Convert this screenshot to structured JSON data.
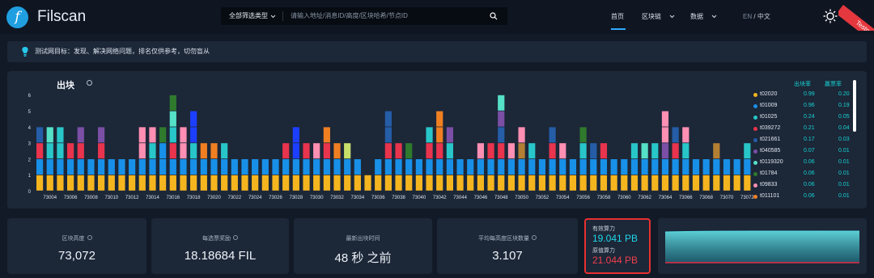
{
  "brand": {
    "name": "Filscan",
    "logo_glyph": "f"
  },
  "search": {
    "filter_label": "全部筛选类型",
    "placeholder": "请输入地址/消息ID/高度/区块哈希/节点ID"
  },
  "nav": {
    "home": "首页",
    "blockchain": "区块链",
    "data": "数据",
    "lang_en": "EN",
    "lang_sep": "/",
    "lang_zh": "中文"
  },
  "ribbon": {
    "label": "Testnet"
  },
  "notice": {
    "text": "测试网目标：发现、解决网络问题，排名仅供参考，切勿盲从"
  },
  "chart_panel": {
    "title": "出块",
    "legend_header_a": "出块率",
    "legend_header_b": "赢票率",
    "legend": [
      {
        "name": "t02020",
        "a": "0.99",
        "b": "0.20",
        "color": "#f5b51f"
      },
      {
        "name": "t01009",
        "a": "0.96",
        "b": "0.19",
        "color": "#1890e8"
      },
      {
        "name": "t01025",
        "a": "0.24",
        "b": "0.05",
        "color": "#28c6c8"
      },
      {
        "name": "t039272",
        "a": "0.21",
        "b": "0.04",
        "color": "#e8344d"
      },
      {
        "name": "t021661",
        "a": "0.17",
        "b": "0.03",
        "color": "#255da7"
      },
      {
        "name": "t040585",
        "a": "0.07",
        "b": "0.01",
        "color": "#7b4fa6"
      },
      {
        "name": "t0119320",
        "a": "0.06",
        "b": "0.01",
        "color": "#55e0c8"
      },
      {
        "name": "t01784",
        "a": "0.06",
        "b": "0.01",
        "color": "#2f7a2d"
      },
      {
        "name": "t09833",
        "a": "0.06",
        "b": "0.01",
        "color": "#ff8fb3"
      },
      {
        "name": "t011101",
        "a": "0.06",
        "b": "0.01",
        "color": "#f07f22"
      }
    ]
  },
  "chart_data": {
    "type": "bar",
    "title": "出块",
    "ylim": [
      0,
      6
    ],
    "yticks": [
      "0",
      "1",
      "2",
      "3",
      "4",
      "5",
      "6"
    ],
    "xtick_labels": [
      "73004",
      "73006",
      "73008",
      "73010",
      "73012",
      "73014",
      "73016",
      "73018",
      "73020",
      "73022",
      "73024",
      "73026",
      "73028",
      "73030",
      "73032",
      "73034",
      "73036",
      "73038",
      "73040",
      "73042",
      "73044",
      "73046",
      "73048",
      "73050",
      "73052",
      "73054",
      "73056",
      "73058",
      "73060",
      "73062",
      "73064",
      "73066",
      "73068",
      "73070",
      "73072"
    ],
    "categories": [
      73003,
      73004,
      73005,
      73006,
      73007,
      73008,
      73009,
      73010,
      73011,
      73012,
      73013,
      73014,
      73015,
      73016,
      73017,
      73018,
      73019,
      73020,
      73021,
      73022,
      73023,
      73024,
      73025,
      73026,
      73027,
      73028,
      73029,
      73030,
      73031,
      73032,
      73033,
      73034,
      73035,
      73036,
      73037,
      73038,
      73039,
      73040,
      73041,
      73042,
      73043,
      73044,
      73045,
      73046,
      73047,
      73048,
      73049,
      73050,
      73051,
      73052,
      73053,
      73054,
      73055,
      73056,
      73057,
      73058,
      73059,
      73060,
      73061,
      73062,
      73063,
      73064,
      73065,
      73066,
      73067,
      73068,
      73069,
      73070,
      73071,
      73072
    ],
    "stacks": [
      [
        "#f5b51f",
        "#1890e8",
        "#e8344d",
        "#255da7"
      ],
      [
        "#f5b51f",
        "#1890e8",
        "#28c6c8",
        "#55e0c8"
      ],
      [
        "#f5b51f",
        "#1890e8",
        "#28c6c8",
        "#28c6c8"
      ],
      [
        "#f5b51f",
        "#1890e8",
        "#e8344d"
      ],
      [
        "#f5b51f",
        "#1890e8",
        "#e8344d",
        "#7b4fa6"
      ],
      [
        "#f5b51f",
        "#1890e8"
      ],
      [
        "#f5b51f",
        "#1890e8",
        "#e8344d",
        "#7b4fa6"
      ],
      [
        "#f5b51f",
        "#1890e8"
      ],
      [
        "#f5b51f",
        "#1890e8"
      ],
      [
        "#f5b51f",
        "#1890e8"
      ],
      [
        "#f5b51f",
        "#1890e8",
        "#ff8fb3",
        "#ff8fb3"
      ],
      [
        "#f5b51f",
        "#1890e8",
        "#28c6c8",
        "#ff8fb3"
      ],
      [
        "#f5b51f",
        "#1890e8",
        "#1890e8",
        "#2f7a2d"
      ],
      [
        "#f5b51f",
        "#1890e8",
        "#e8344d",
        "#28c6c8",
        "#55e0c8",
        "#2f7a2d"
      ],
      [
        "#f5b51f",
        "#1890e8",
        "#ff8fb3",
        "#ff8fb3"
      ],
      [
        "#f5b51f",
        "#1890e8",
        "#28c6c8",
        "#1c3fff",
        "#1c3fff"
      ],
      [
        "#f5b51f",
        "#1890e8",
        "#f07f22"
      ],
      [
        "#f5b51f",
        "#1890e8",
        "#f07f22"
      ],
      [
        "#f5b51f",
        "#1890e8",
        "#28c6c8"
      ],
      [
        "#f5b51f",
        "#1890e8"
      ],
      [
        "#f5b51f",
        "#1890e8"
      ],
      [
        "#f5b51f",
        "#1890e8"
      ],
      [
        "#f5b51f",
        "#1890e8"
      ],
      [
        "#f5b51f",
        "#1890e8"
      ],
      [
        "#f5b51f",
        "#1890e8",
        "#e8344d"
      ],
      [
        "#f5b51f",
        "#1890e8",
        "#1c3fff",
        "#1c3fff"
      ],
      [
        "#f5b51f",
        "#1890e8",
        "#e8344d"
      ],
      [
        "#f5b51f",
        "#1890e8",
        "#ff8fb3"
      ],
      [
        "#f5b51f",
        "#1890e8",
        "#e8344d",
        "#f07f22"
      ],
      [
        "#f5b51f",
        "#1890e8",
        "#f07f22"
      ],
      [
        "#f5b51f",
        "#1890e8",
        "#c8e06a"
      ],
      [
        "#f5b51f",
        "#1890e8"
      ],
      [
        "#f5b51f"
      ],
      [
        "#f5b51f",
        "#1890e8"
      ],
      [
        "#f5b51f",
        "#1890e8",
        "#e8344d",
        "#255da7",
        "#255da7"
      ],
      [
        "#f5b51f",
        "#1890e8",
        "#e8344d"
      ],
      [
        "#f5b51f",
        "#1890e8",
        "#2f7a2d"
      ],
      [
        "#f5b51f",
        "#1890e8"
      ],
      [
        "#f5b51f",
        "#1890e8",
        "#e8344d",
        "#28c6c8"
      ],
      [
        "#f5b51f",
        "#1890e8",
        "#e8344d",
        "#f07f22",
        "#f07f22"
      ],
      [
        "#f5b51f",
        "#1890e8",
        "#28c6c8",
        "#7b4fa6"
      ],
      [
        "#f5b51f",
        "#1890e8"
      ],
      [
        "#f5b51f",
        "#1890e8"
      ],
      [
        "#f5b51f",
        "#1890e8",
        "#ff8fb3"
      ],
      [
        "#f5b51f",
        "#1890e8",
        "#e8344d"
      ],
      [
        "#f5b51f",
        "#1890e8",
        "#e8344d",
        "#255da7",
        "#7b4fa6",
        "#55e0c8"
      ],
      [
        "#f5b51f",
        "#1890e8",
        "#ff8fb3"
      ],
      [
        "#f5b51f",
        "#1890e8",
        "#b37f33",
        "#ff8fb3"
      ],
      [
        "#f5b51f",
        "#1890e8",
        "#28c6c8"
      ],
      [
        "#f5b51f",
        "#1890e8"
      ],
      [
        "#f5b51f",
        "#1890e8",
        "#e8344d",
        "#255da7"
      ],
      [
        "#f5b51f",
        "#1890e8",
        "#ff8fb3"
      ],
      [
        "#f5b51f",
        "#1890e8"
      ],
      [
        "#f5b51f",
        "#1890e8",
        "#28c6c8",
        "#2f7a2d"
      ],
      [
        "#f5b51f",
        "#1890e8",
        "#255da7"
      ],
      [
        "#f5b51f",
        "#1890e8",
        "#e8344d"
      ],
      [
        "#f5b51f",
        "#1890e8"
      ],
      [
        "#f5b51f",
        "#1890e8"
      ],
      [
        "#f5b51f",
        "#1890e8",
        "#28c6c8"
      ],
      [
        "#f5b51f",
        "#1890e8",
        "#55e0c8"
      ],
      [
        "#f5b51f",
        "#1890e8",
        "#28c6c8"
      ],
      [
        "#f5b51f",
        "#1890e8",
        "#7b4fa6",
        "#ff8fb3",
        "#ff8fb3"
      ],
      [
        "#f5b51f",
        "#1890e8",
        "#e8344d",
        "#255da7"
      ],
      [
        "#f5b51f",
        "#1890e8",
        "#28c6c8",
        "#ff8fb3"
      ],
      [
        "#f5b51f",
        "#1890e8"
      ],
      [
        "#f5b51f",
        "#1890e8"
      ],
      [
        "#f5b51f",
        "#1890e8",
        "#b37f33"
      ],
      [
        "#f5b51f",
        "#1890e8"
      ],
      [
        "#f5b51f",
        "#1890e8"
      ],
      [
        "#f5b51f",
        "#1890e8",
        "#28c6c8"
      ]
    ]
  },
  "stats": [
    {
      "label": "区块高度",
      "value": "73,072"
    },
    {
      "label": "每选票奖励",
      "value": "18.18684 FIL"
    },
    {
      "label": "最新出块时间",
      "value": "48 秒 之前"
    },
    {
      "label": "平均每高度区块数量",
      "value": "3.107"
    }
  ],
  "power": {
    "effective_label": "有效算力",
    "effective_value": "19.041 PB",
    "raw_label": "原值算力",
    "raw_value": "21.044 PB"
  }
}
